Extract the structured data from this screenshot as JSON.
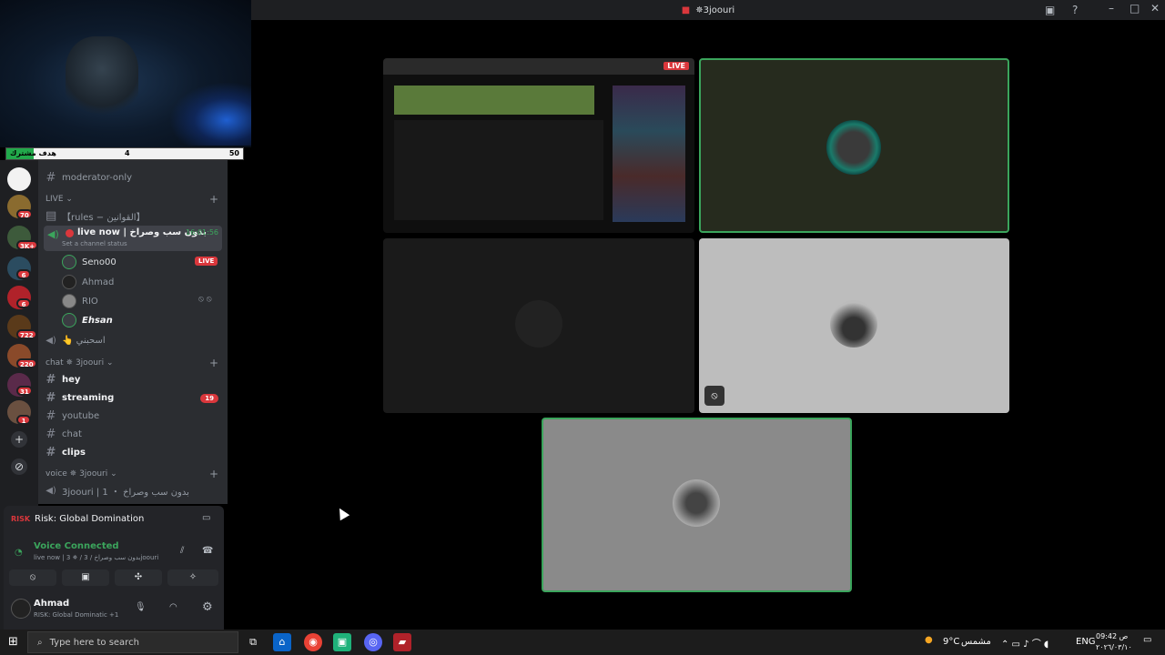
{
  "window": {
    "title": "3joouri"
  },
  "overlay": {
    "label": "هدف مشترك",
    "current": "4",
    "goal": "50",
    "progress": 0.08
  },
  "channels": {
    "moderator": "moderator-only",
    "live_category": "LIVE",
    "rules": "【rules − القوانين】",
    "live_channel": "live now | بدون سب وصراخ",
    "live_timer": "16:01:56",
    "channel_status": "Set a channel status",
    "voice_users": [
      {
        "name": "Seno00",
        "live": "LIVE"
      },
      {
        "name": "Ahmad"
      },
      {
        "name": "RIO"
      },
      {
        "name": "Ehsan"
      }
    ],
    "voice2": "👆 اسحبني",
    "chat_category": "chat ✵ 3joouri",
    "text_channels": [
      {
        "name": "hey",
        "bold": true
      },
      {
        "name": "streaming",
        "bold": true,
        "badge": "19"
      },
      {
        "name": "youtube",
        "bold": false
      },
      {
        "name": "chat",
        "bold": false
      },
      {
        "name": "clips",
        "bold": true
      }
    ],
    "voice_category": "voice ✵ 3joouri",
    "voice_channel": "3joouri | 1 ・ بدون سب وصراخ"
  },
  "servers": {
    "badges": [
      "70",
      "3K+",
      "6",
      "6",
      "722",
      "220",
      "31",
      "1"
    ]
  },
  "panel": {
    "activity": "Risk: Global Domination",
    "voice_status": "Voice Connected",
    "voice_detail": "live now | 3 ✵ / بدون سب وصراخ / 3joouri",
    "user_name": "Ahmad",
    "user_activity": "RISK: Global Dominatic +1"
  },
  "stream": {
    "live_label": "LIVE"
  },
  "taskbar": {
    "search_placeholder": "Type here to search",
    "weather": "9°C",
    "weather_text": "مشمس",
    "lang": "ENG",
    "time": "09:42 ص",
    "date": "٢٠٢٦/٠٣/١٠"
  },
  "colors": {
    "green": "#3ba55c",
    "red": "#da373c",
    "discord_bg": "#2b2d31"
  }
}
